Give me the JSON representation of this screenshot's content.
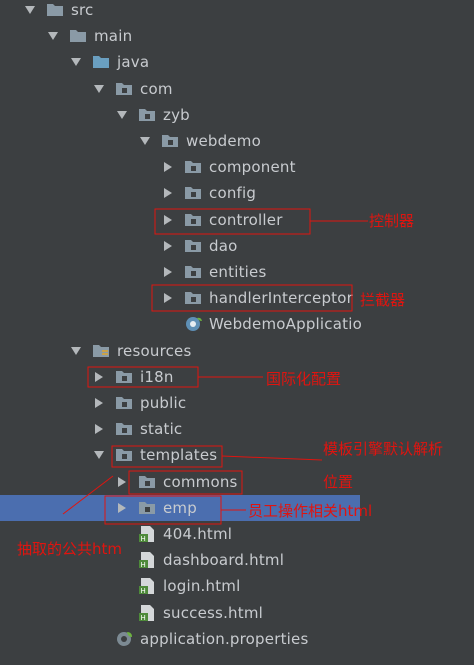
{
  "tree": {
    "items": [
      {
        "name": "src",
        "label": "src",
        "type": "folder",
        "expanded": true
      },
      {
        "name": "main",
        "label": "main",
        "type": "folder",
        "expanded": true
      },
      {
        "name": "java",
        "label": "java",
        "type": "src-folder",
        "expanded": true
      },
      {
        "name": "com",
        "label": "com",
        "type": "package",
        "expanded": true
      },
      {
        "name": "zyb",
        "label": "zyb",
        "type": "package",
        "expanded": true
      },
      {
        "name": "webdemo",
        "label": "webdemo",
        "type": "package",
        "expanded": true
      },
      {
        "name": "component",
        "label": "component",
        "type": "package",
        "expanded": false
      },
      {
        "name": "config",
        "label": "config",
        "type": "package",
        "expanded": false
      },
      {
        "name": "controller",
        "label": "controller",
        "type": "package",
        "expanded": false
      },
      {
        "name": "dao",
        "label": "dao",
        "type": "package",
        "expanded": false
      },
      {
        "name": "entities",
        "label": "entities",
        "type": "package",
        "expanded": false
      },
      {
        "name": "handlerinterceptor",
        "label": "handlerInterceptor",
        "type": "package",
        "expanded": false
      },
      {
        "name": "webdemoapplication",
        "label": "WebdemoApplicatio",
        "type": "spring-class"
      },
      {
        "name": "resources",
        "label": "resources",
        "type": "res-folder",
        "expanded": true
      },
      {
        "name": "i18n",
        "label": "i18n",
        "type": "package",
        "expanded": false
      },
      {
        "name": "public",
        "label": "public",
        "type": "package",
        "expanded": false
      },
      {
        "name": "static",
        "label": "static",
        "type": "package",
        "expanded": false
      },
      {
        "name": "templates",
        "label": "templates",
        "type": "package",
        "expanded": true
      },
      {
        "name": "commons",
        "label": "commons",
        "type": "package",
        "expanded": false
      },
      {
        "name": "emp",
        "label": "emp",
        "type": "package",
        "expanded": false,
        "selected": true
      },
      {
        "name": "404-html",
        "label": "404.html",
        "type": "html"
      },
      {
        "name": "dashboard-html",
        "label": "dashboard.html",
        "type": "html"
      },
      {
        "name": "login-html",
        "label": "login.html",
        "type": "html"
      },
      {
        "name": "success-html",
        "label": "success.html",
        "type": "html"
      },
      {
        "name": "application-properties",
        "label": "application.properties",
        "type": "properties"
      }
    ]
  },
  "annotations": {
    "controller": "控制器",
    "interceptor": "拦截器",
    "i18n": "国际化配置",
    "templates_line1": "模板引擎默认解析",
    "templates_line2": "位置",
    "emp": "员工操作相关html",
    "commons": "抽取的公共htm"
  },
  "colors": {
    "background": "#3c3f41",
    "selection": "#4b6eaf",
    "text": "#c8cbcf",
    "annotation": "#e0140f",
    "folder": "#8a9aa6",
    "src_folder": "#6a9fc0",
    "html_badge": "#4e8a3a"
  }
}
